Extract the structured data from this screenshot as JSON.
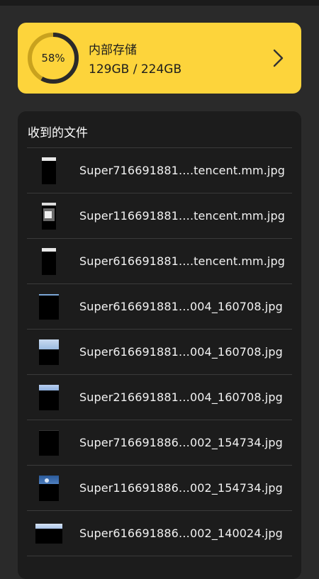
{
  "storage": {
    "percent_label": "58%",
    "used_fraction": 0.58,
    "title": "内部存储",
    "size": "129GB / 224GB",
    "accent": "#fdd43b",
    "ring_fill": "#2a2a2a",
    "ring_track": "#c9a21e"
  },
  "files": {
    "title": "收到的文件",
    "items": [
      {
        "name": "Super716691881….tencent.mm.jpg",
        "thumb": "portrait-white-top"
      },
      {
        "name": "Super116691881….tencent.mm.jpg",
        "thumb": "portrait-gray-window"
      },
      {
        "name": "Super616691881….tencent.mm.jpg",
        "thumb": "portrait-white-top"
      },
      {
        "name": "Super616691881…004_160708.jpg",
        "thumb": "dark-blue-edge"
      },
      {
        "name": "Super616691881…004_160708.jpg",
        "thumb": "sky-top"
      },
      {
        "name": "Super216691881…004_160708.jpg",
        "thumb": "sky-strip"
      },
      {
        "name": "Super716691886…002_154734.jpg",
        "thumb": "dark-plain"
      },
      {
        "name": "Super116691886…002_154734.jpg",
        "thumb": "blue-landscape"
      },
      {
        "name": "Super616691886…002_140024.jpg",
        "thumb": "wide-sky"
      }
    ]
  }
}
